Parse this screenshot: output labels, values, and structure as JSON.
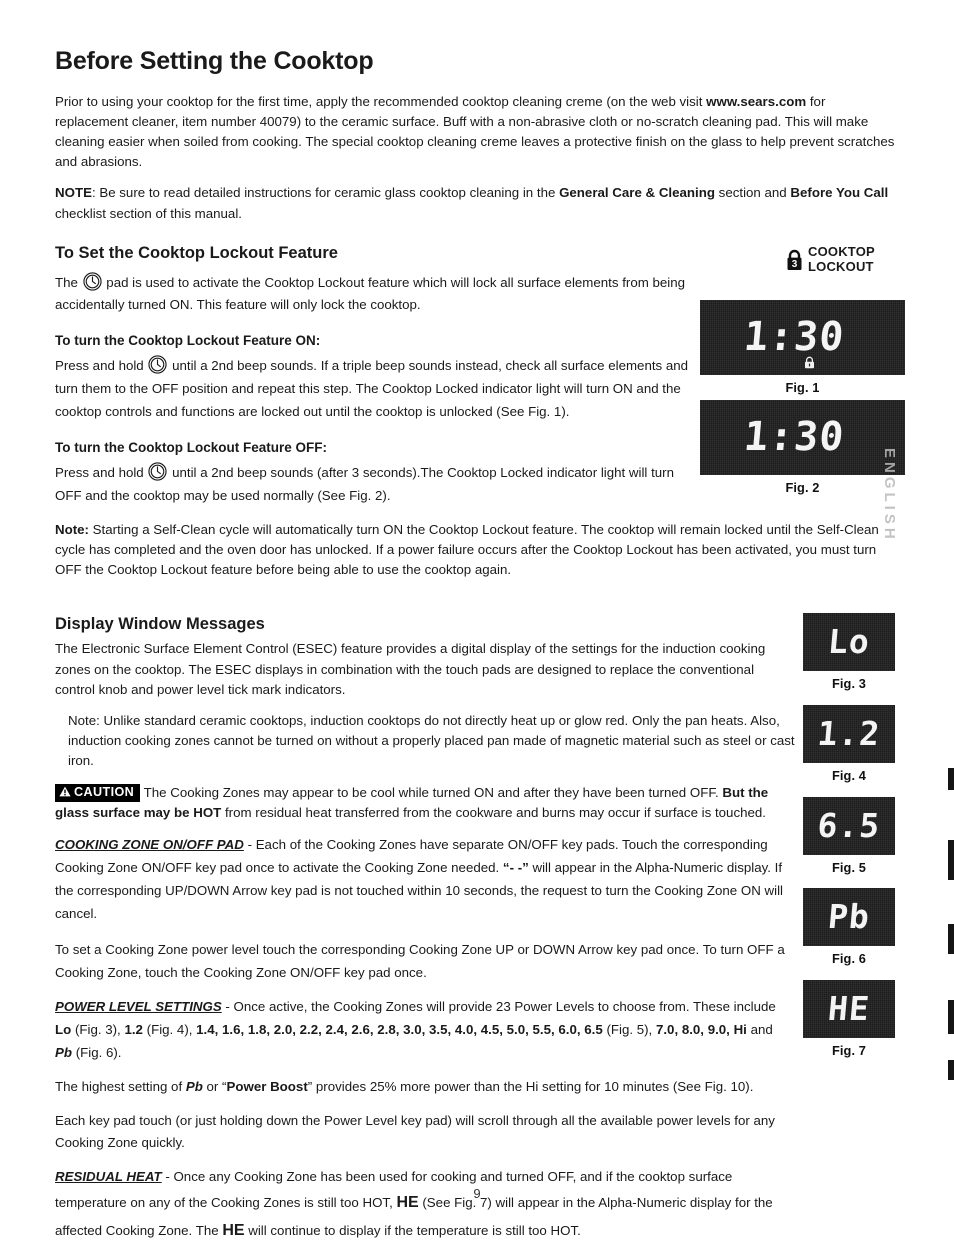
{
  "page": {
    "title": "Before Setting the Cooktop",
    "number": "9",
    "margin_mark": "ENGLISH"
  },
  "intro": {
    "p1_a": "Prior to using your cooktop for the first time, apply the recommended cooktop cleaning creme (on the web visit ",
    "p1_link": "www.sears.com",
    "p1_b": " for replacement cleaner, item number 40079) to the ceramic surface. Buff with a non-abrasive cloth or no-scratch cleaning pad. This will make cleaning easier when soiled from cooking. The special cooktop cleaning creme leaves a protective finish on the glass to help prevent scratches and abrasions.",
    "note_label": "NOTE",
    "note_a": ":  Be sure to read detailed instructions for ceramic glass cooktop cleaning in the ",
    "note_b1": "General Care & Cleaning",
    "note_c": " section and ",
    "note_b2": "Before You Call",
    "note_d": " checklist section of this manual."
  },
  "lockout_section": {
    "heading": "To Set the Cooktop Lockout Feature",
    "intro_a": "The ",
    "intro_b": " pad is used to activate the Cooktop Lockout feature which will lock all surface elements from being accidentally turned ON. This feature will only lock the cooktop.",
    "on_heading": "To turn the Cooktop Lockout Feature ON:",
    "on_a": "Press and hold ",
    "on_b": " until a 2nd beep sounds. If a triple beep sounds instead, check all surface elements and turn them to the OFF position and repeat this step. The Cooktop Locked indicator light will turn ON and the cooktop controls and functions are locked out until the cooktop is unlocked (See Fig. 1).",
    "off_heading": "To turn the Cooktop Lockout Feature OFF:",
    "off_a": "Press and hold ",
    "off_b": " until a 2nd beep sounds (after 3 seconds).The Cooktop Locked indicator light will turn OFF and the cooktop may be used normally (See Fig. 2).",
    "note_label": "Note:",
    "note_text": " Starting a Self-Clean cycle will automatically turn ON the Cooktop Lockout feature. The cooktop will remain locked until the Self-Clean cycle has completed and the oven door has unlocked. If a power failure occurs after the Cooktop Lockout has been activated, you must turn OFF the Cooktop Lockout feature before being able to use the cooktop again."
  },
  "cooktop_lockout_legend": {
    "line1": "COOKTOP",
    "line2": "LOCKOUT",
    "badge_number": "3",
    "icon": "padlock-icon"
  },
  "display_section": {
    "heading": "Display Window Messages",
    "p1": "The Electronic Surface Element Control (ESEC) feature provides a digital display of the settings for the induction cooking zones on the cooktop. The ESEC displays in combination with the touch pads are designed to replace the conventional control knob and power level tick mark indicators.",
    "p2": "Note: Unlike standard ceramic cooktops, induction cooktops do not directly heat up or glow red. Only the pan heats. Also, induction cooking zones cannot be turned on without a properly placed pan made of magnetic material such as steel or cast iron.",
    "caution_label": "CAUTION",
    "caution_a": " The Cooking Zones may appear to be cool while turned ON and after they have been turned OFF. ",
    "caution_b": "But the glass surface may be HOT",
    "caution_c": " from residual heat transferred from the cookware and burns may occur if surface is touched.",
    "zone_pad_heading": "COOKING ZONE ON/OFF PAD",
    "zone_pad_a": " - Each of the Cooking Zones have separate ON/OFF key pads. Touch the corresponding Cooking Zone ON/OFF key pad once to activate the Cooking Zone needed. ",
    "zone_pad_quote": "“- -”",
    "zone_pad_b": " will appear in the Alpha-Numeric display. If the corresponding UP/DOWN Arrow key pad is not touched within 10 seconds, the request to turn the Cooking Zone ON will cancel.",
    "set_power": "To set a Cooking Zone power level touch the corresponding Cooking Zone UP or DOWN Arrow key pad once. To turn OFF a Cooking Zone, touch the Cooking Zone ON/OFF key pad once.",
    "power_heading": "POWER LEVEL SETTINGS",
    "power_a": " - Once active, the Cooking Zones will provide 23 Power Levels to choose from. These include ",
    "power_lo": "Lo",
    "power_fig3": " (Fig. 3), ",
    "power_12": "1.2",
    "power_fig4": " (Fig. 4), ",
    "power_list1": "1.4, 1.6, 1.8, 2.0, 2.2, 2.4, 2.6, 2.8, 3.0, 3.5, 4.0, 4.5, 5.0, 5.5, 6.0, 6.5",
    "power_fig5": " (Fig. 5), ",
    "power_list2": "7.0, 8.0, 9.0, Hi",
    "power_and": " and ",
    "power_pb": "Pb",
    "power_fig6": " (Fig. 6).",
    "boost_a": "The highest setting of ",
    "boost_pb": "Pb",
    "boost_b": " or “",
    "boost_label": "Power Boost",
    "boost_c": "” provides 25% more power than the Hi setting for 10 minutes (See Fig. 10).",
    "scroll": "Each key pad touch (or just holding down the Power Level key pad) will scroll through all the available power levels for any Cooking Zone quickly.",
    "residual_heading": "RESIDUAL HEAT",
    "residual_a": " - Once any Cooking Zone has been used for cooking and turned OFF, and if the cooktop surface temperature on any of the Cooking Zones is still too HOT, ",
    "residual_he1": "HE",
    "residual_b": "  (See Fig. 7) will appear in the Alpha-Numeric display for the affected Cooking Zone. The ",
    "residual_he2": "HE",
    "residual_c": "  will continue to display if the temperature is still too HOT."
  },
  "figures": [
    {
      "id": "fig1",
      "caption": "Fig. 1",
      "display": "1:30",
      "lock_indicator": true,
      "size": "time"
    },
    {
      "id": "fig2",
      "caption": "Fig. 2",
      "display": "1:30",
      "lock_indicator": false,
      "size": "time"
    },
    {
      "id": "fig3",
      "caption": "Fig. 3",
      "display": "Lo",
      "lock_indicator": false,
      "size": "small"
    },
    {
      "id": "fig4",
      "caption": "Fig. 4",
      "display": "1.2",
      "lock_indicator": false,
      "size": "small"
    },
    {
      "id": "fig5",
      "caption": "Fig. 5",
      "display": "6.5",
      "lock_indicator": false,
      "size": "small"
    },
    {
      "id": "fig6",
      "caption": "Fig. 6",
      "display": "Pb",
      "lock_indicator": false,
      "size": "small"
    },
    {
      "id": "fig7",
      "caption": "Fig. 7",
      "display": "HE",
      "lock_indicator": false,
      "size": "small"
    }
  ],
  "colors": {
    "display_bg": "#1c1c1c",
    "display_text": "#f4f4f4",
    "ink": "#1a1a1a",
    "caution_bg": "#000000"
  }
}
